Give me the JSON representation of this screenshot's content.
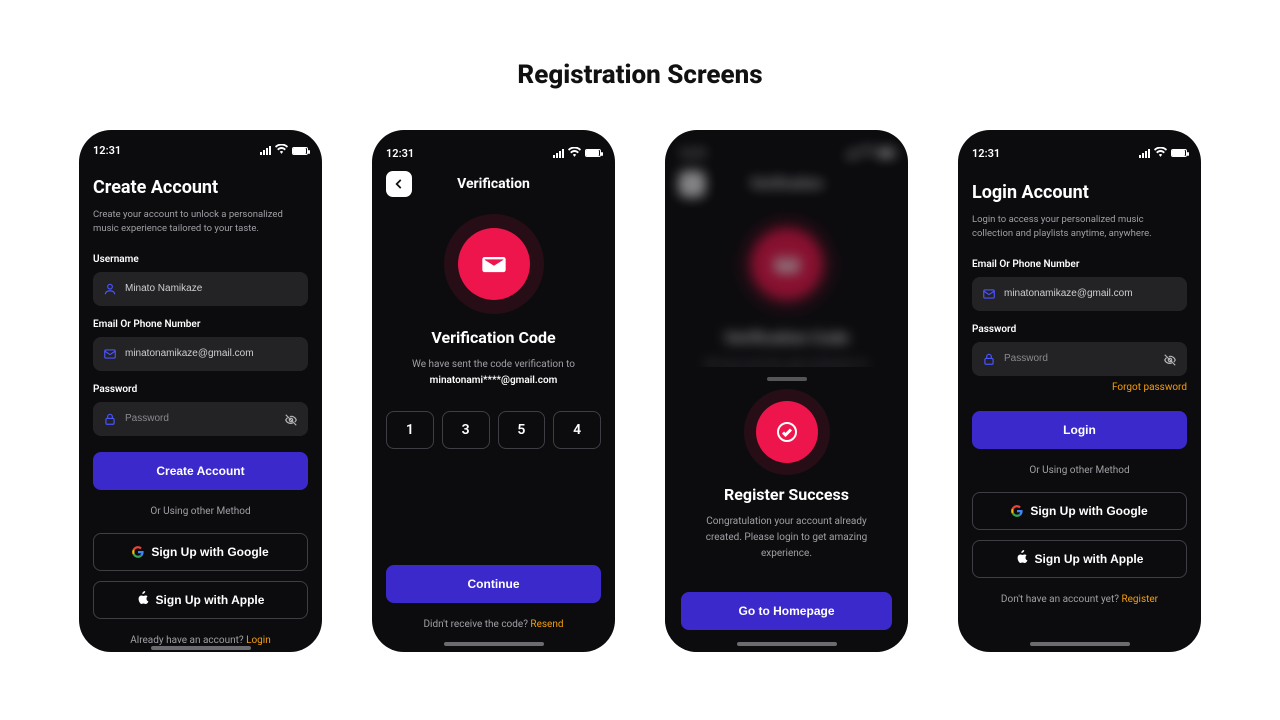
{
  "page_title": "Registration Screens",
  "status": {
    "time": "12:31"
  },
  "screen1": {
    "title": "Create Account",
    "subtitle": "Create your account to unlock a personalized music experience tailored to your taste.",
    "username_label": "Username",
    "username_value": "Minato Namikaze",
    "email_label": "Email Or Phone Number",
    "email_value": "minatonamikaze@gmail.com",
    "password_label": "Password",
    "password_placeholder": "Password",
    "primary_button": "Create Account",
    "alt_method": "Or Using other Method",
    "google": "Sign Up with Google",
    "apple": "Sign Up with Apple",
    "already": "Already have an account? ",
    "login_link": "Login"
  },
  "screen2": {
    "header": "Verification",
    "title": "Verification Code",
    "sent_text": "We have sent the code verification to",
    "sent_email": "minatonami****@gmail.com",
    "code": [
      "1",
      "3",
      "5",
      "4"
    ],
    "continue": "Continue",
    "didnt": "Didn't receive the code? ",
    "resend": "Resend"
  },
  "screen3": {
    "success_title": "Register Success",
    "success_sub": "Congratulation your account already created. Please login to get amazing experience.",
    "homepage": "Go to Homepage"
  },
  "screen4": {
    "title": "Login Account",
    "subtitle": "Login to access your personalized music collection and playlists anytime, anywhere.",
    "email_label": "Email Or Phone Number",
    "email_value": "minatonamikaze@gmail.com",
    "password_label": "Password",
    "password_placeholder": "Password",
    "forgot": "Forgot password",
    "login": "Login",
    "alt_method": "Or Using other Method",
    "google": "Sign Up with Google",
    "apple": "Sign Up with Apple",
    "no_account": "Don't have an account yet? ",
    "register_link": "Register"
  }
}
